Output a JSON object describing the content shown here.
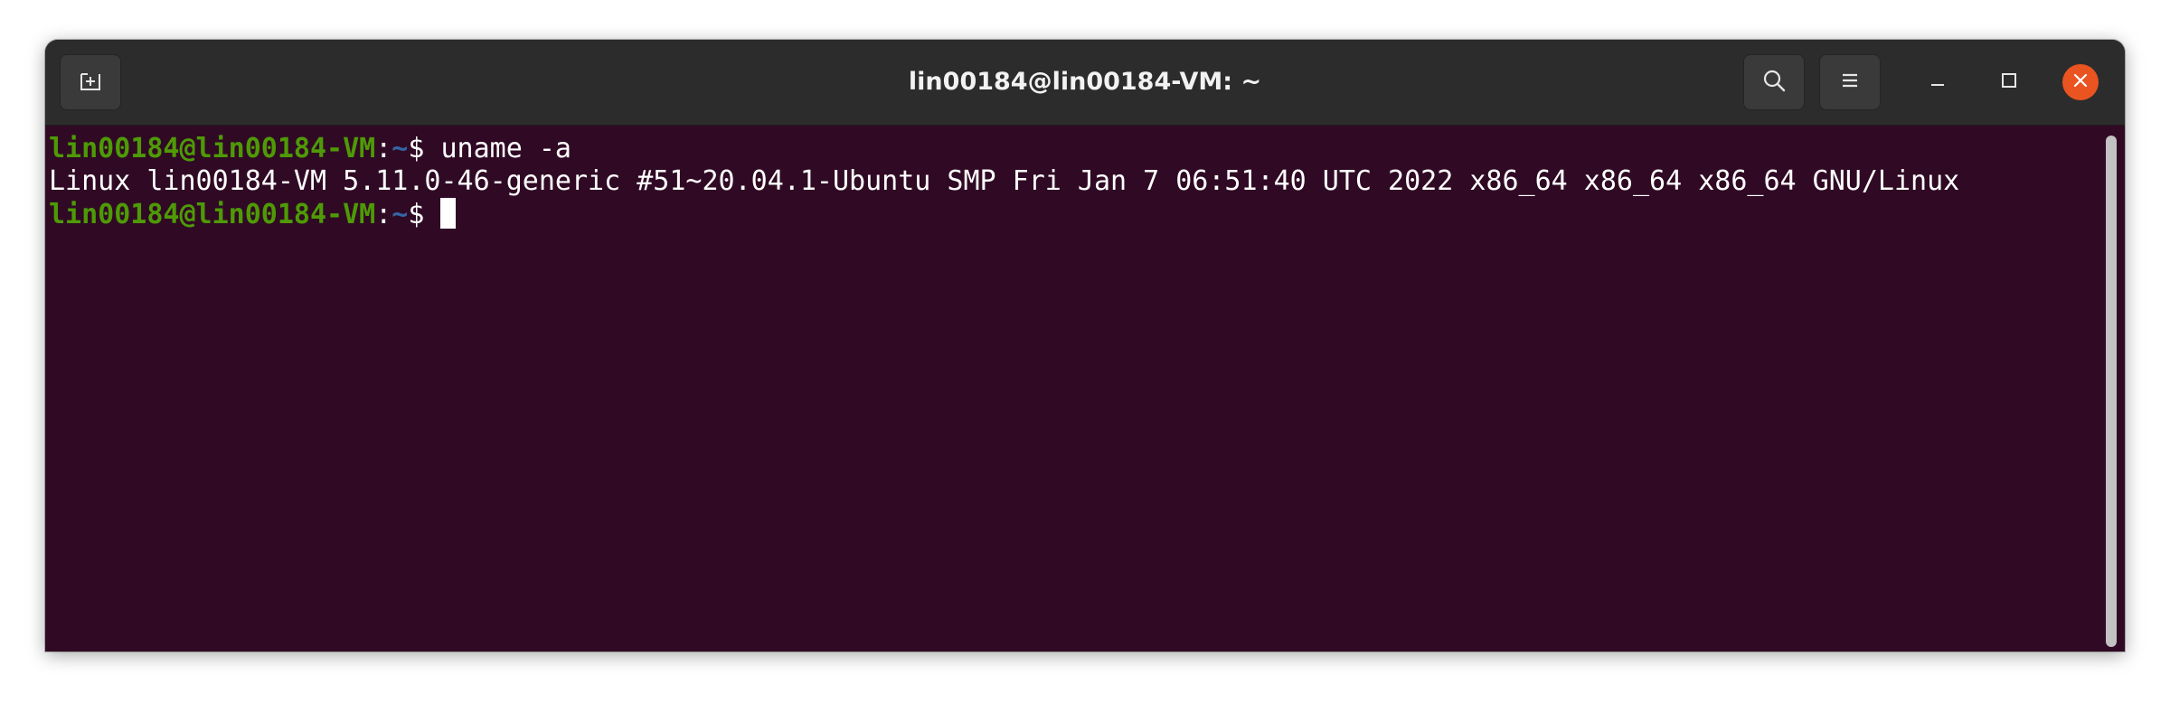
{
  "window": {
    "title": "lin00184@lin00184-VM: ~"
  },
  "toolbar": {
    "new_tab_icon": "new-tab-icon",
    "search_icon": "search-icon",
    "menu_icon": "hamburger-menu-icon",
    "minimize_icon": "minimize-icon",
    "maximize_icon": "maximize-icon",
    "close_icon": "close-icon"
  },
  "terminal": {
    "lines": [
      {
        "user_host": "lin00184@lin00184-VM",
        "colon": ":",
        "path": "~",
        "dollar": "$ ",
        "command": "uname -a"
      },
      {
        "output": "Linux lin00184-VM 5.11.0-46-generic #51~20.04.1-Ubuntu SMP Fri Jan 7 06:51:40 UTC 2022 x86_64 x86_64 x86_64 GNU/Linux"
      },
      {
        "user_host": "lin00184@lin00184-VM",
        "colon": ":",
        "path": "~",
        "dollar": "$ ",
        "command": ""
      }
    ]
  },
  "colors": {
    "terminal_bg": "#300a24",
    "titlebar_bg": "#2c2c2c",
    "prompt_user": "#4e9a06",
    "prompt_path": "#3465a4",
    "close_button": "#e95420"
  }
}
